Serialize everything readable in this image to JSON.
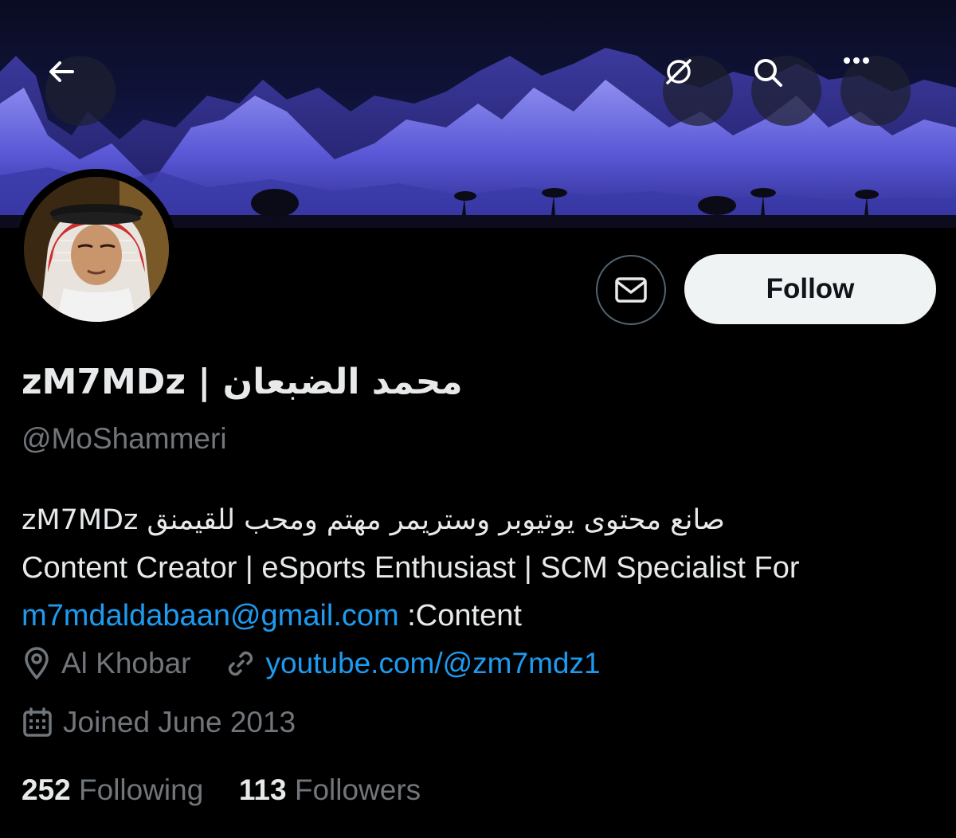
{
  "profile": {
    "display_name": "محمد الضبعان | zM7MDz",
    "handle": "@MoShammeri",
    "bio_line1": "zM7MDz صانع محتوى يوتيوبر وستريمر مهتم ومحب للقيمنق",
    "bio_line2": "Content Creator | eSports Enthusiast | SCM Specialist For",
    "bio_email": "m7mdaldabaan@gmail.com",
    "bio_content_label": " :Content",
    "location": "Al Khobar",
    "website": "youtube.com/@zm7mdz1",
    "joined": "Joined June 2013",
    "following_count": "252",
    "following_label": "Following",
    "followers_count": "113",
    "followers_label": "Followers"
  },
  "actions": {
    "follow_label": "Follow"
  },
  "icons": {
    "back": "back-arrow-icon",
    "grok": "grok-icon",
    "search": "search-icon",
    "more": "more-icon",
    "mail": "mail-icon",
    "location": "location-pin-icon",
    "link": "link-icon",
    "calendar": "calendar-icon"
  },
  "colors": {
    "background": "#000000",
    "primary_text": "#e7e9ea",
    "secondary_text": "#71767b",
    "link": "#1d9bf0",
    "follow_bg": "#eff3f4"
  }
}
